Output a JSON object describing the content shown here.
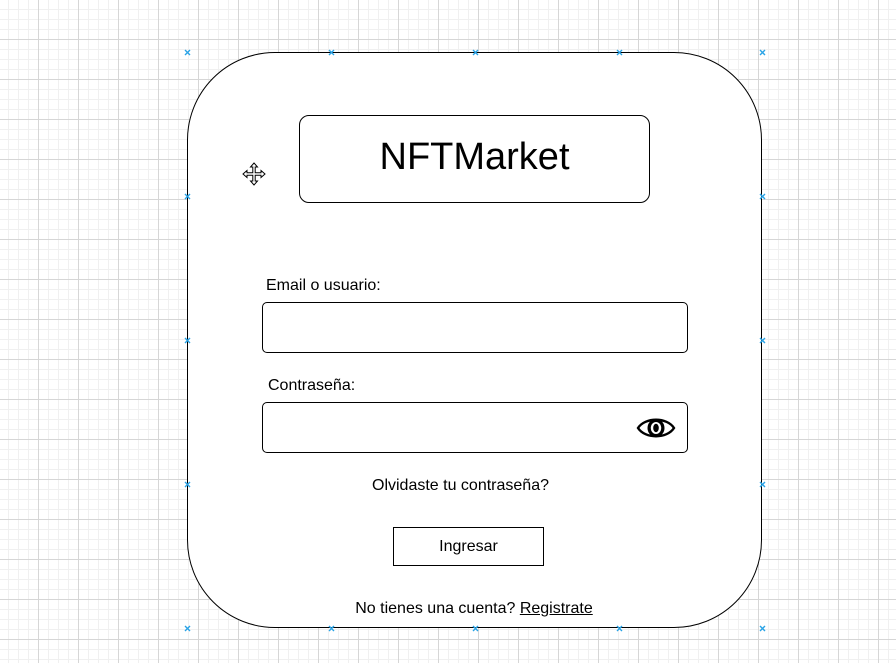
{
  "app": {
    "title": "NFTMarket"
  },
  "form": {
    "email_label": "Email o usuario:",
    "email_value": "",
    "password_label": "Contraseña:",
    "password_value": "",
    "forgot_password": "Olvidaste tu contraseña?",
    "submit_label": "Ingresar",
    "signup_prompt": "No tienes una cuenta?",
    "signup_link": "Registrate"
  },
  "icons": {
    "move": "move-arrows-icon",
    "password_toggle": "eye-icon",
    "selection_handle": "selection-handle-icon"
  },
  "colors": {
    "selection_handle": "#29a3e6",
    "border": "#000000",
    "grid": "#d6d6d6"
  }
}
